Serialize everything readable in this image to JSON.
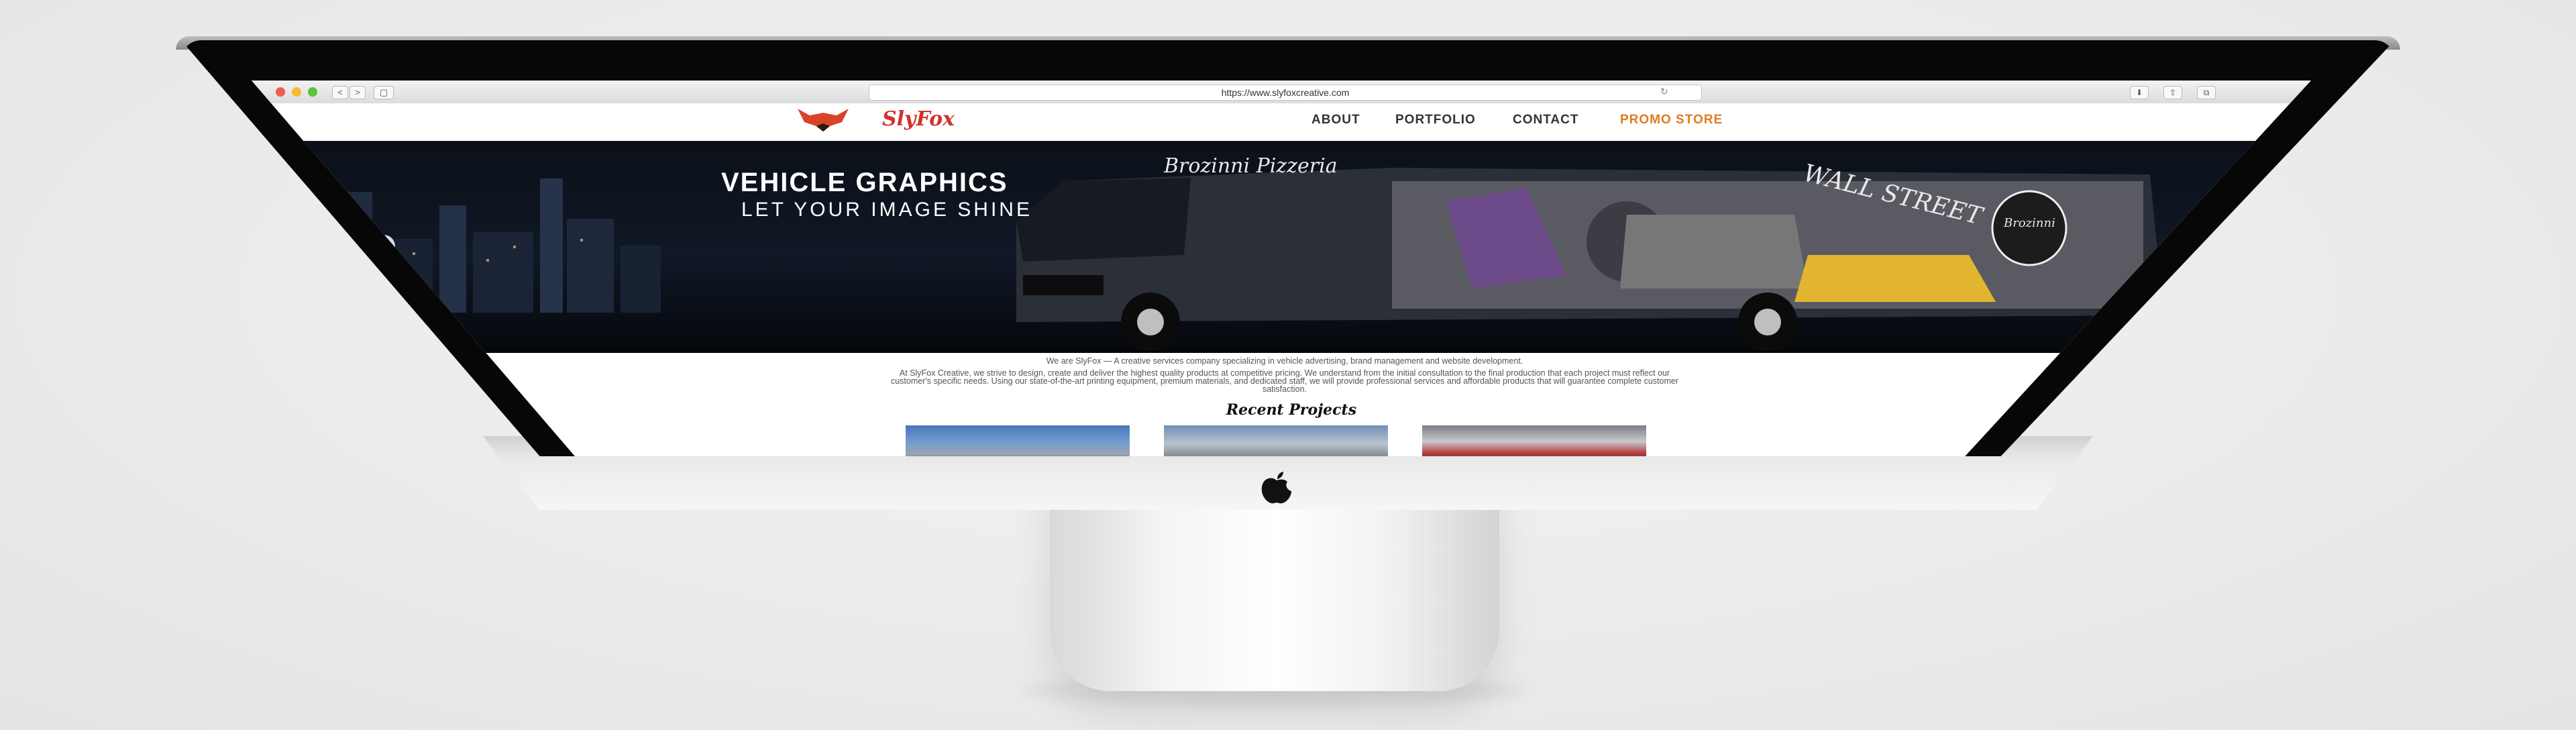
{
  "browser": {
    "url": "https://www.slyfoxcreative.com",
    "back_label": "<",
    "forward_label": ">",
    "reload_label": "↻"
  },
  "site": {
    "brand": "SlyFox",
    "nav": [
      {
        "label": "ABOUT"
      },
      {
        "label": "PORTFOLIO"
      },
      {
        "label": "CONTACT"
      },
      {
        "label": "PROMO STORE"
      }
    ],
    "accent_color": "#e27b1f",
    "brand_color": "#d1322c"
  },
  "hero": {
    "title": "VEHICLE GRAPHICS",
    "subtitle": "LET YOUR IMAGE SHINE",
    "truck_lettering": "Brozinni Pizzeria",
    "truck_side_text": "WALL STREET",
    "badge_text": "Brozinni",
    "prev_label": "‹",
    "next_label": "›"
  },
  "content": {
    "intro_line1": "We are SlyFox — A creative services company specializing in vehicle advertising, brand management and website development.",
    "intro_line2": "At SlyFox Creative, we strive to design, create and deliver the highest quality products at competitive pricing. We understand from the initial consultation to the final production that each project must reflect our customer's specific needs. Using our state-of-the-art printing equipment, premium materials, and dedicated staff, we will provide professional services and affordable products that will guarantee complete customer satisfaction.",
    "recent_heading": "Recent Projects"
  }
}
